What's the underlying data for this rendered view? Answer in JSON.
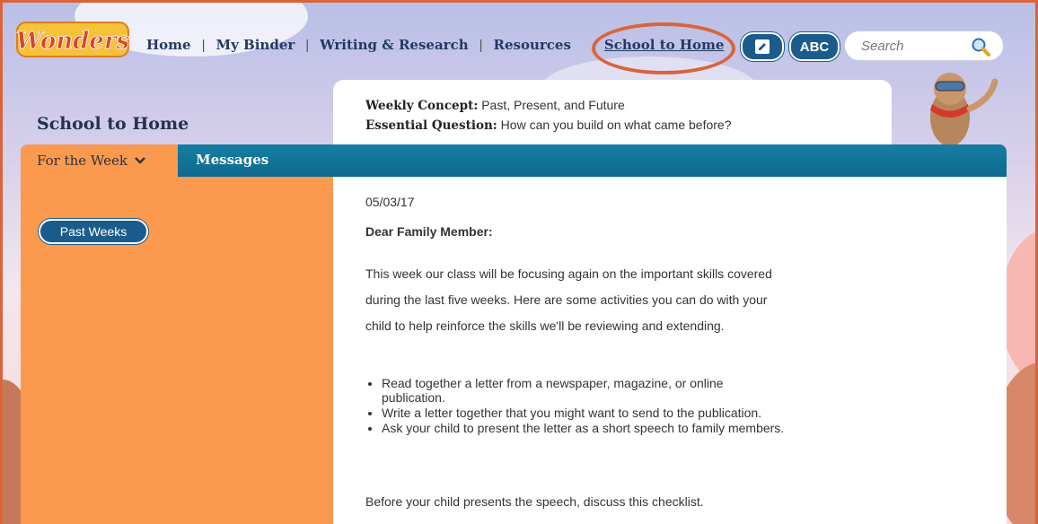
{
  "brand": {
    "logo_text": "Wonders"
  },
  "nav": {
    "items": [
      "Home",
      "My Binder",
      "Writing & Research",
      "Resources"
    ],
    "active": "School to Home",
    "edit_icon": "edit-icon",
    "abc_label": "ABC"
  },
  "search": {
    "placeholder": "Search",
    "icon": "search-icon"
  },
  "page": {
    "title": "School to Home"
  },
  "concept": {
    "weekly_label": "Weekly Concept",
    "weekly_value": "Past, Present, and Future",
    "question_label": "Essential Question",
    "question_value": "How can you build on what came before?"
  },
  "tabs": {
    "week_label": "For the Week",
    "messages_label": "Messages"
  },
  "sidebar": {
    "past_weeks_label": "Past Weeks"
  },
  "letter": {
    "date": "05/03/17",
    "salutation": "Dear Family Member:",
    "paragraph": "This week our class will be focusing again on the important skills covered during the last five weeks. Here are some activities you can do with your child to help reinforce the skills we'll be reviewing and extending.",
    "bullets": [
      "Read together a letter from a newspaper, magazine, or online publication.",
      "Write a letter together that you might want to send to the publication.",
      "Ask your child to present the letter as a short speech to family members."
    ],
    "closing": "Before your child presents the speech, discuss this checklist."
  },
  "colors": {
    "accent_orange": "#fb9a4f",
    "tab_blue": "#0e6a8e",
    "button_blue": "#1b5c8c",
    "highlight_ring": "#d9643a"
  }
}
